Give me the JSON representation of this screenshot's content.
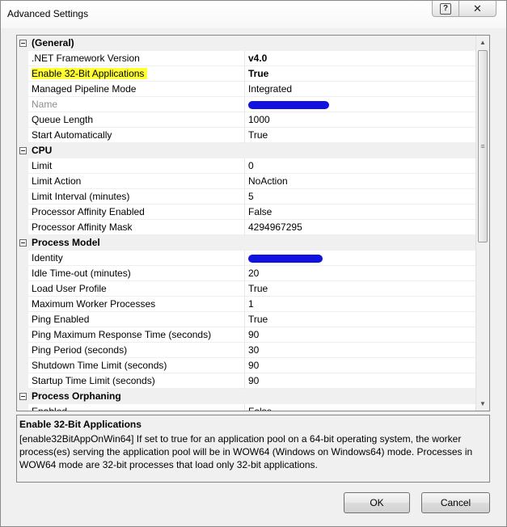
{
  "window": {
    "title": "Advanced Settings",
    "help_glyph": "?",
    "close_glyph": "✕"
  },
  "grid": {
    "categories": [
      {
        "label": "(General)",
        "props": [
          {
            "name": ".NET Framework Version",
            "value": "v4.0",
            "bold": true
          },
          {
            "name": "Enable 32-Bit Applications",
            "value": "True",
            "bold": true,
            "highlight": true
          },
          {
            "name": "Managed Pipeline Mode",
            "value": "Integrated"
          },
          {
            "name": "Name",
            "value": "",
            "disabled": true,
            "redacted": true
          },
          {
            "name": "Queue Length",
            "value": "1000"
          },
          {
            "name": "Start Automatically",
            "value": "True"
          }
        ]
      },
      {
        "label": "CPU",
        "props": [
          {
            "name": "Limit",
            "value": "0"
          },
          {
            "name": "Limit Action",
            "value": "NoAction"
          },
          {
            "name": "Limit Interval (minutes)",
            "value": "5"
          },
          {
            "name": "Processor Affinity Enabled",
            "value": "False"
          },
          {
            "name": "Processor Affinity Mask",
            "value": "4294967295"
          }
        ]
      },
      {
        "label": "Process Model",
        "props": [
          {
            "name": "Identity",
            "value": "",
            "redacted": true
          },
          {
            "name": "Idle Time-out (minutes)",
            "value": "20"
          },
          {
            "name": "Load User Profile",
            "value": "True"
          },
          {
            "name": "Maximum Worker Processes",
            "value": "1"
          },
          {
            "name": "Ping Enabled",
            "value": "True"
          },
          {
            "name": "Ping Maximum Response Time (seconds)",
            "value": "90"
          },
          {
            "name": "Ping Period (seconds)",
            "value": "30"
          },
          {
            "name": "Shutdown Time Limit (seconds)",
            "value": "90"
          },
          {
            "name": "Startup Time Limit (seconds)",
            "value": "90"
          }
        ]
      },
      {
        "label": "Process Orphaning",
        "props": [
          {
            "name": "Enabled",
            "value": "False"
          }
        ]
      }
    ]
  },
  "description": {
    "title": "Enable 32-Bit Applications",
    "text": "[enable32BitAppOnWin64] If set to true for an application pool on a 64-bit operating system, the worker process(es) serving the application pool will be in WOW64 (Windows on Windows64) mode. Processes in WOW64 mode are 32-bit processes that load only 32-bit applications."
  },
  "buttons": {
    "ok_label": "OK",
    "cancel_label": "Cancel"
  },
  "colors": {
    "highlight": "#ffff33",
    "redaction": "#1212e0"
  },
  "icons": {
    "collapse": "collapse-icon",
    "scroll_up": "scroll-up-icon",
    "scroll_down": "scroll-down-icon"
  }
}
